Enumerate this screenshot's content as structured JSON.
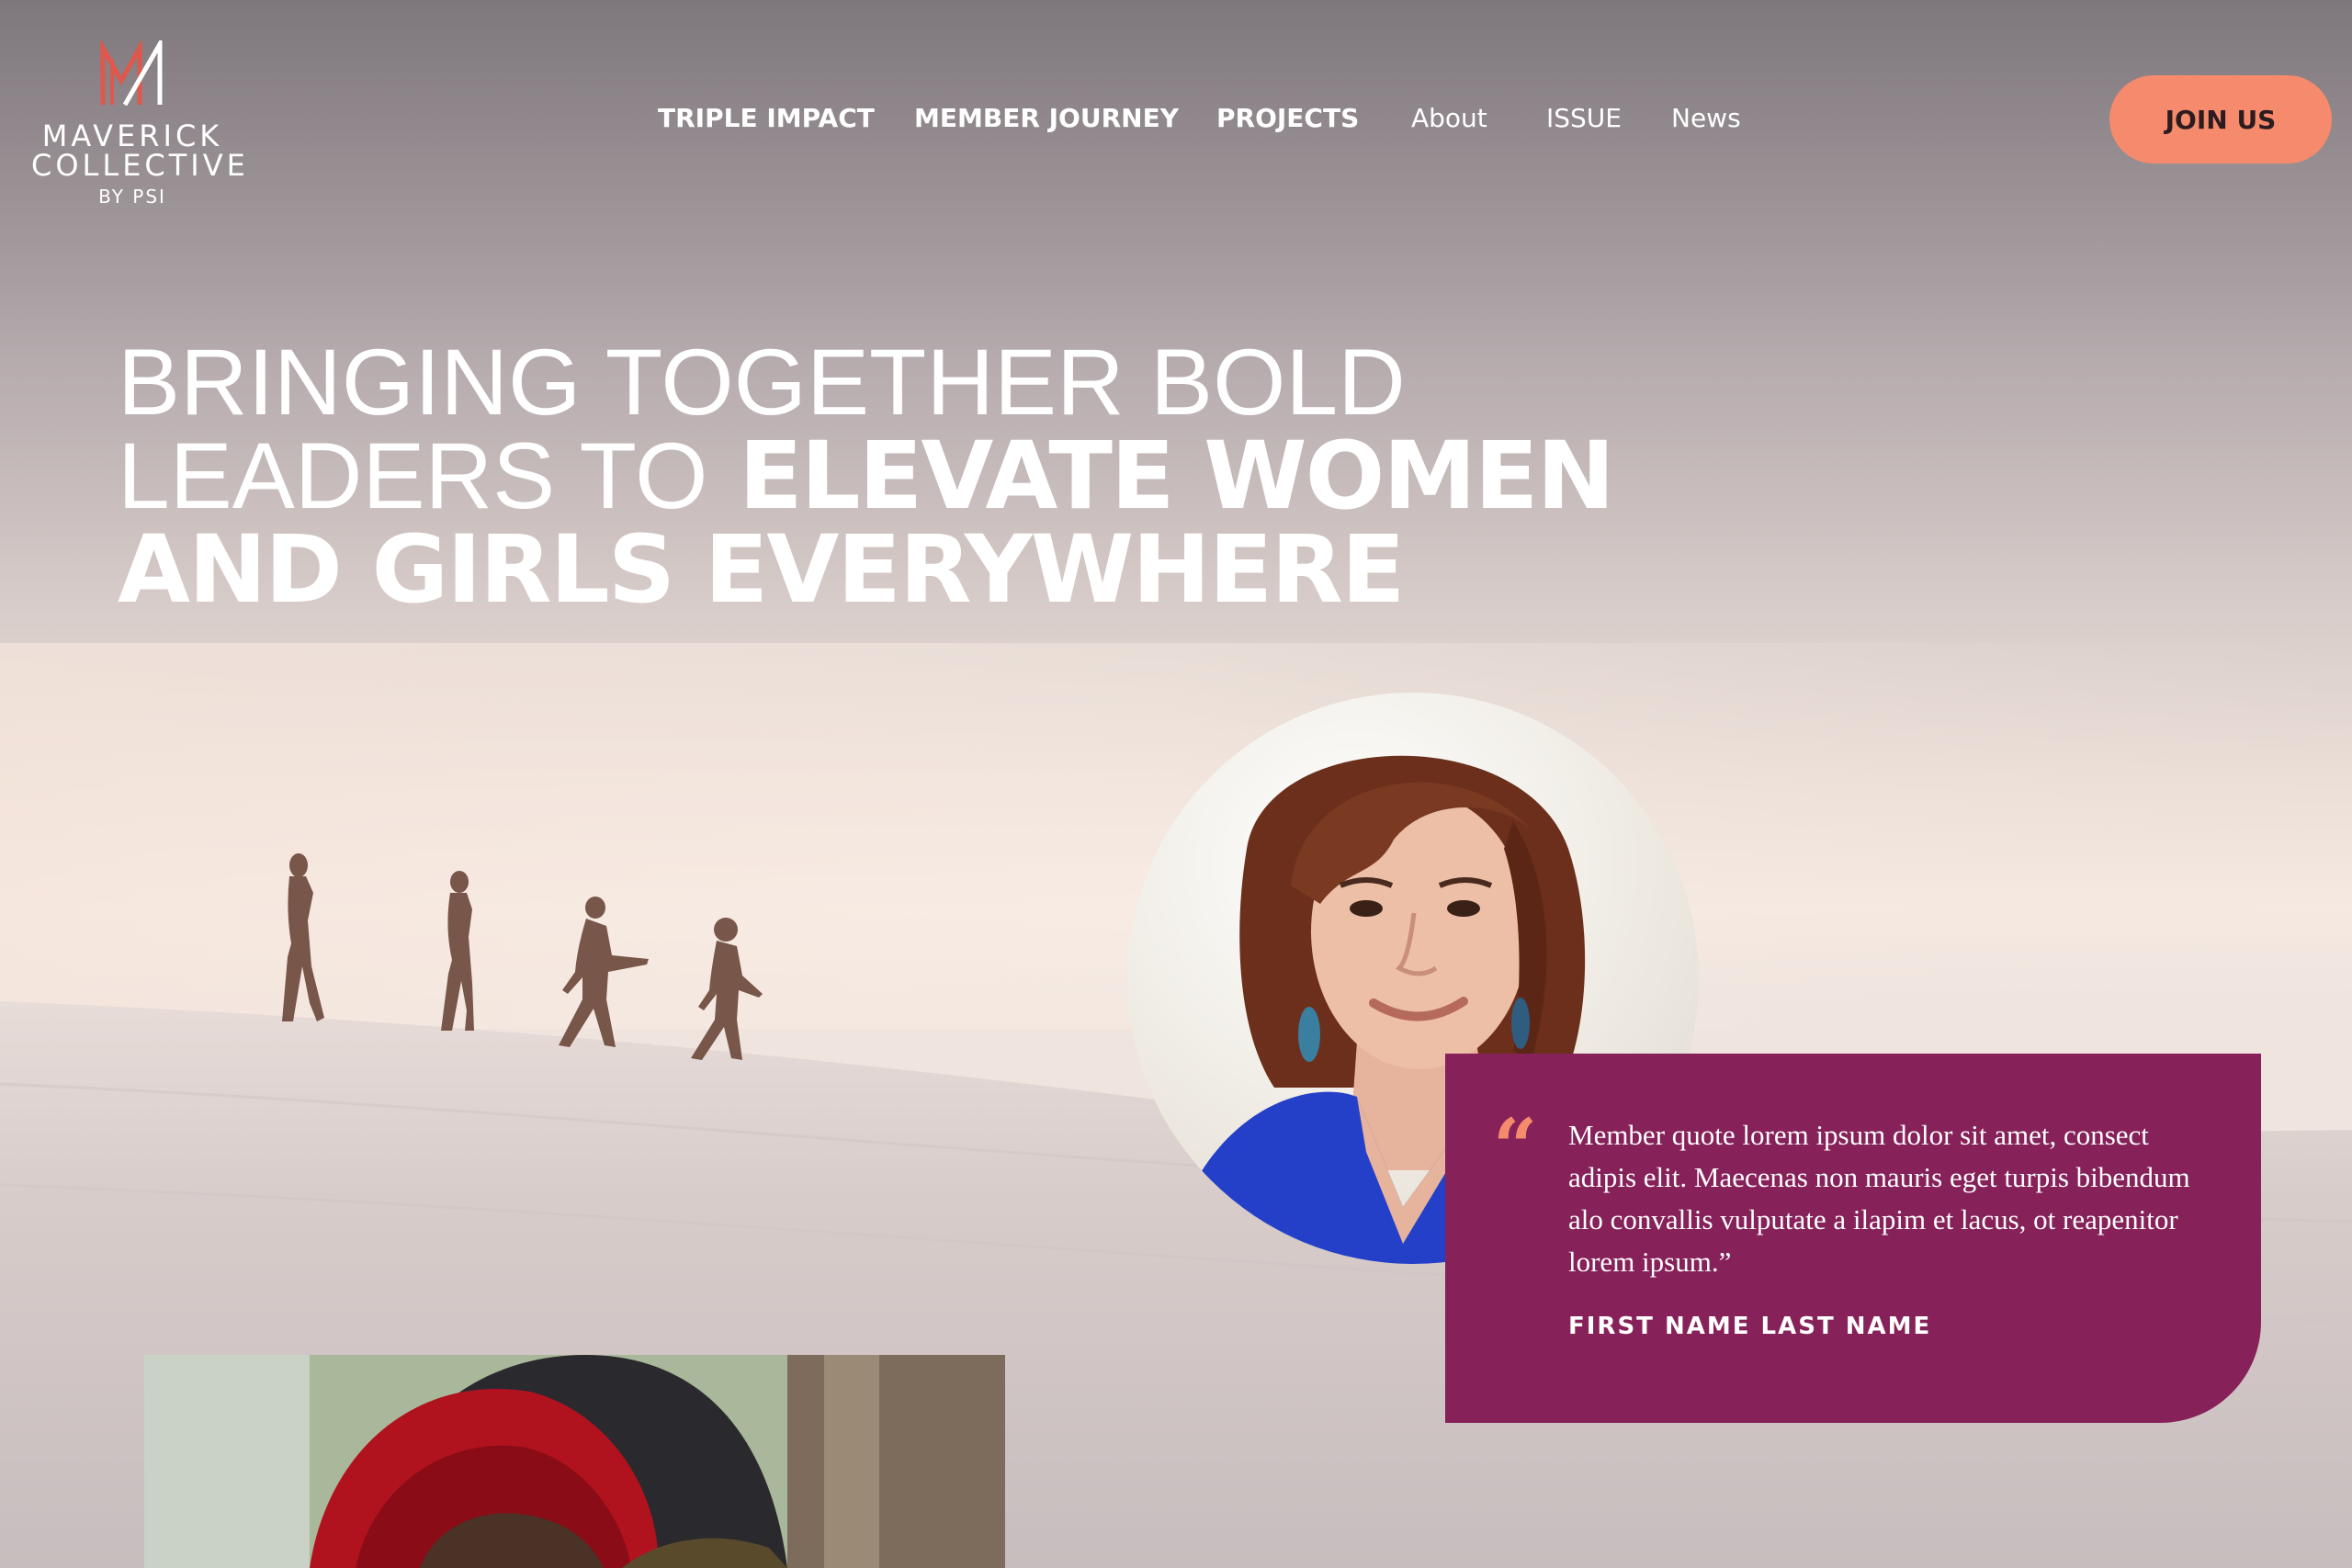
{
  "brand": {
    "logo_line1": "MAVERICK",
    "logo_line2": "COLLECTIVE",
    "logo_by": "BY PSI",
    "logo_icon": "maverick-m-icon",
    "accent_color": "#f68a6c"
  },
  "nav": {
    "items": [
      {
        "label": "TRIPLE IMPACT"
      },
      {
        "label": "MEMBER JOURNEY"
      },
      {
        "label": "PROJECTS"
      },
      {
        "label": "About"
      },
      {
        "label": "ISSUE"
      },
      {
        "label": "News"
      }
    ],
    "cta_label": "JOIN US"
  },
  "hero": {
    "line1": "BRINGING TOGETHER BOLD",
    "line2_light": "LEADERS TO",
    "line2_bold": "ELEVATE WOMEN",
    "line3": "AND GIRLS EVERYWHERE"
  },
  "quote": {
    "icon": "quote-icon",
    "text": "Member quote lorem ipsum dolor sit amet, consect adipis elit. Maecenas non mauris eget turpis bibendum alo convallis vulputate a ilapim et lacus, ot reapenitor lorem ipsum.”",
    "name": "FIRST NAME LAST NAME",
    "card_color": "#862159"
  }
}
